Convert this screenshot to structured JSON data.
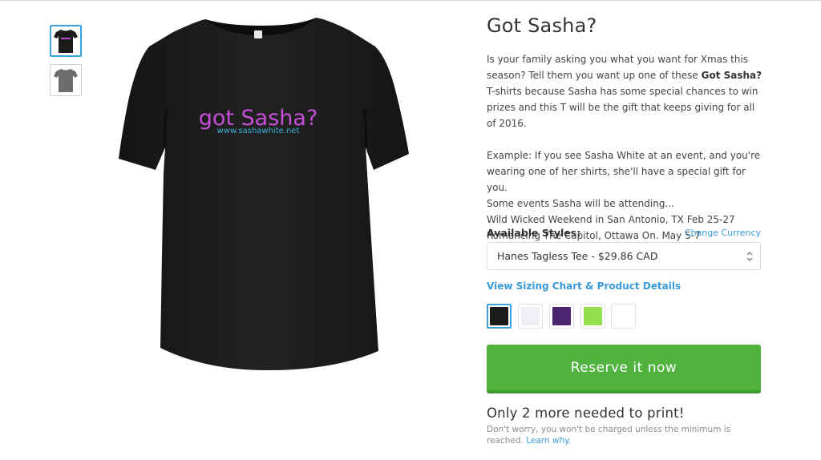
{
  "product": {
    "title": "Got Sasha?",
    "shirt_print": {
      "main": "got Sasha?",
      "sub": "www.sashawhite.net"
    },
    "thumbnails": [
      {
        "name": "black-shirt",
        "color": "#1b1b1b",
        "selected": true
      },
      {
        "name": "gray-shirt",
        "color": "#6d6d6d",
        "selected": false
      }
    ]
  },
  "description": {
    "p1_a": "Is your family asking you what you want for Xmas this season? Tell them you want up one of these ",
    "p1_bold": "Got Sasha?",
    "p1_b": " T-shirts because Sasha has some special chances to win prizes and  this T will be the gift that keeps giving for all of 2016.",
    "p2": "Example: If you see Sasha White at an event, and you're wearing one of her shirts, she'll have a special gift for you.",
    "p3": "Some events Sasha will be attending...",
    "p4": "Wild Wicked Weekend in San Antonio, TX Feb 25-27",
    "p5": "Romancing The Capitol, Ottawa On. May 5-7"
  },
  "styles": {
    "label": "Available Styles:",
    "change_currency": "Change Currency",
    "selected": "Hanes Tagless Tee - $29.86 CAD",
    "sizing_link": "View Sizing Chart & Product Details"
  },
  "colors": [
    {
      "name": "black",
      "hex": "#1b1b1b",
      "selected": true
    },
    {
      "name": "white",
      "hex": "#eef0f5",
      "selected": false
    },
    {
      "name": "purple",
      "hex": "#4b2570",
      "selected": false
    },
    {
      "name": "lime",
      "hex": "#94e04c",
      "selected": false
    },
    {
      "name": "white-2",
      "hex": "#ffffff",
      "selected": false
    }
  ],
  "cta": {
    "reserve_label": "Reserve it now",
    "needed_text": "Only 2 more needed to print!",
    "note_text": "Don't worry, you won't be charged unless the minimum is reached. ",
    "learn_why": "Learn why."
  },
  "theme": {
    "accent_blue": "#3a9ad9",
    "button_green": "#4fb33e",
    "print_pink": "#c64fd8",
    "print_cyan": "#3bb0d8"
  }
}
